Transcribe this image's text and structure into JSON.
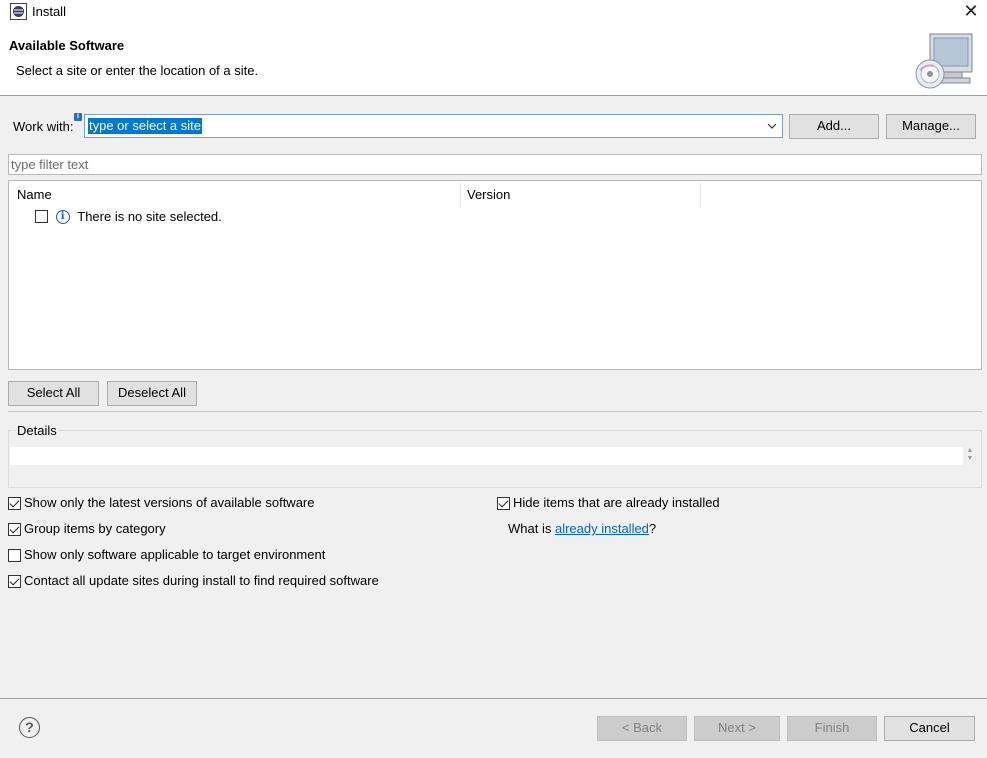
{
  "window": {
    "title": "Install",
    "close_glyph": "✕",
    "icon": "eclipse-icon"
  },
  "header": {
    "title": "Available Software",
    "description": "Select a site or enter the location of a site.",
    "image": "monitor-cd-icon"
  },
  "work_with": {
    "label": "Work with:",
    "info_decoration": "i",
    "value": "type or select a site",
    "add_label": "Add...",
    "manage_label": "Manage..."
  },
  "filter": {
    "placeholder": "type filter text"
  },
  "tree": {
    "columns": [
      "Name",
      "Version"
    ],
    "rows": [
      {
        "checked": false,
        "icon": "info-icon",
        "text": "There is no site selected."
      }
    ]
  },
  "selection": {
    "select_all_label": "Select All",
    "deselect_all_label": "Deselect All"
  },
  "details": {
    "label": "Details",
    "text": ""
  },
  "options": {
    "latest_versions": {
      "label": "Show only the latest versions of available software",
      "checked": true
    },
    "group_by_category": {
      "label": "Group items by category",
      "checked": true
    },
    "applicable_only": {
      "label": "Show only software applicable to target environment",
      "checked": false
    },
    "contact_all": {
      "label": "Contact all update sites during install to find required software",
      "checked": true
    },
    "hide_installed": {
      "label": "Hide items that are already installed",
      "checked": true
    },
    "what_is_prefix": "What is ",
    "what_is_link": "already installed",
    "what_is_suffix": "?"
  },
  "footer": {
    "help_glyph": "?",
    "back_label": "< Back",
    "next_label": "Next >",
    "finish_label": "Finish",
    "cancel_label": "Cancel"
  }
}
